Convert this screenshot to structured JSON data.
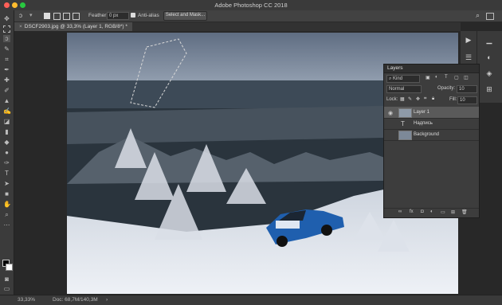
{
  "app": {
    "title": "Adobe Photoshop CC 2018"
  },
  "options": {
    "feather_label": "Feather:",
    "feather_value": "0 px",
    "antialias_label": "Anti-alias",
    "select_mask_label": "Select and Mask..."
  },
  "document": {
    "tab_label": "DSCF2903.jpg @ 33,3% (Layer 1, RGB/8*) *"
  },
  "layers_panel": {
    "title": "Layers",
    "filter_kind": "Kind",
    "blend_mode": "Normal",
    "opacity_label": "Opacity:",
    "opacity_value": "10",
    "lock_label": "Lock:",
    "fill_label": "Fill:",
    "fill_value": "10",
    "layers": [
      {
        "name": "Layer 1"
      },
      {
        "name": "Надпись"
      },
      {
        "name": "Background"
      }
    ]
  },
  "status": {
    "zoom": "33,33%",
    "doc_info": "Doc: 68,7M/140,3M"
  },
  "colors": {
    "car_blue": "#1f5fae",
    "sky": "#6d7b8f",
    "snow": "#e4e8ef"
  }
}
